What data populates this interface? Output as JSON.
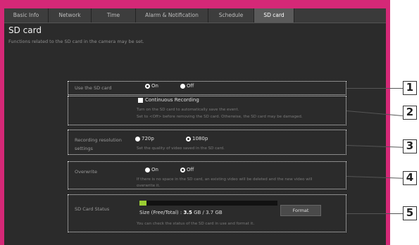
{
  "tabs": [
    {
      "label": "Basic Info",
      "active": false
    },
    {
      "label": "Network",
      "active": false
    },
    {
      "label": "Time",
      "active": false
    },
    {
      "label": "Alarm & Notification",
      "active": false
    },
    {
      "label": "Schedule",
      "active": false
    },
    {
      "label": "SD card",
      "active": true
    }
  ],
  "page": {
    "title": "SD card",
    "subtitle": "Functions related to the SD card in the camera may be set."
  },
  "use_sd": {
    "label": "Use the SD card",
    "on_label": "On",
    "off_label": "Off",
    "selected": "On"
  },
  "continuous": {
    "label": "Continuous Recording",
    "checked": true,
    "desc1": "Turn on the SD card to automatically save the event.",
    "desc2": "Set to <Off> before removing the SD card. Otherwise, the SD card may be damaged."
  },
  "resolution": {
    "label_line1": "Recording resolution",
    "label_line2": "settings",
    "opt1": "720p",
    "opt2": "1080p",
    "selected": "1080p",
    "desc": "Set the quality of video saved in the SD card."
  },
  "overwrite": {
    "label": "Overwrite",
    "on_label": "On",
    "off_label": "Off",
    "selected": "Off",
    "desc1": "If there is no space in the SD card, an existing video will be deleted and the new video will",
    "desc2": "overwrite it."
  },
  "status": {
    "label": "SD Card Status",
    "used_fraction": 0.05,
    "size_prefix": "Size (Free/Total) : ",
    "size_free": "3.5",
    "size_mid": " GB / 3.7 GB",
    "format_label": "Format",
    "desc": "You can check the status of the SD card in use and format it."
  },
  "callouts": [
    "1",
    "2",
    "3",
    "4",
    "5"
  ],
  "colors": {
    "frame": "#d52877",
    "panel": "#2b2b2b",
    "progress_fill": "#9acd32"
  }
}
